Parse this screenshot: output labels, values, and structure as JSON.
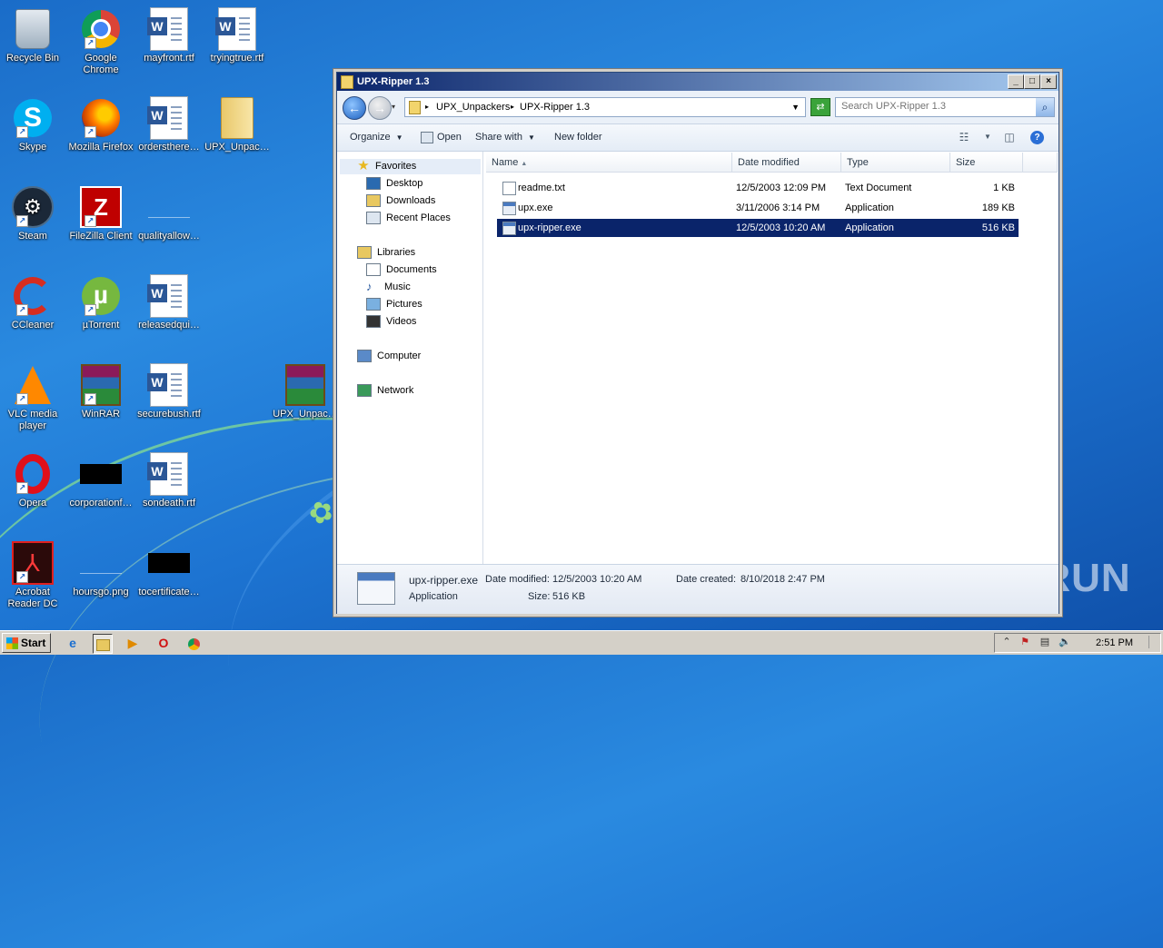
{
  "desktop": {
    "icons": [
      {
        "label": "Recycle Bin",
        "icon": "recycle-bin-icon"
      },
      {
        "label": "Google Chrome",
        "icon": "chrome-icon"
      },
      {
        "label": "mayfront.rtf",
        "icon": "word-doc-icon"
      },
      {
        "label": "tryingtrue.rtf",
        "icon": "word-doc-icon"
      },
      {
        "label": "Skype",
        "icon": "skype-icon"
      },
      {
        "label": "Mozilla Firefox",
        "icon": "firefox-icon"
      },
      {
        "label": "ordersthere…",
        "icon": "word-doc-icon"
      },
      {
        "label": "UPX_Unpac…",
        "icon": "folder-icon"
      },
      {
        "label": "Steam",
        "icon": "steam-icon"
      },
      {
        "label": "FileZilla Client",
        "icon": "filezilla-icon"
      },
      {
        "label": "qualityallow…",
        "icon": "blank-file-icon"
      },
      {
        "label": "CCleaner",
        "icon": "ccleaner-icon"
      },
      {
        "label": "µTorrent",
        "icon": "utorrent-icon"
      },
      {
        "label": "releasedqui…",
        "icon": "word-doc-icon"
      },
      {
        "label": "VLC media player",
        "icon": "vlc-icon"
      },
      {
        "label": "WinRAR",
        "icon": "winrar-icon"
      },
      {
        "label": "securebush.rtf",
        "icon": "word-doc-icon"
      },
      {
        "label": "UPX_Unpac…",
        "icon": "winrar-archive-icon"
      },
      {
        "label": "Opera",
        "icon": "opera-icon"
      },
      {
        "label": "corporationf…",
        "icon": "black-file-icon"
      },
      {
        "label": "sondeath.rtf",
        "icon": "word-doc-icon"
      },
      {
        "label": "Acrobat Reader DC",
        "icon": "acrobat-icon"
      },
      {
        "label": "hoursgo.png",
        "icon": "blank-file-icon"
      },
      {
        "label": "tocertificate…",
        "icon": "black-file-icon"
      }
    ]
  },
  "window": {
    "title": "UPX-Ripper 1.3",
    "controls": {
      "minimize": "_",
      "maximize": "□",
      "close": "×"
    },
    "breadcrumb": [
      "UPX_Unpackers",
      "UPX-Ripper 1.3"
    ],
    "search_placeholder": "Search UPX-Ripper 1.3",
    "toolbar": {
      "organize": "Organize",
      "open": "Open",
      "share_with": "Share with",
      "new_folder": "New folder"
    },
    "nav": {
      "favorites": "Favorites",
      "desktop": "Desktop",
      "downloads": "Downloads",
      "recent_places": "Recent Places",
      "libraries": "Libraries",
      "documents": "Documents",
      "music": "Music",
      "pictures": "Pictures",
      "videos": "Videos",
      "computer": "Computer",
      "network": "Network"
    },
    "columns": {
      "name": "Name",
      "date_modified": "Date modified",
      "type": "Type",
      "size": "Size"
    },
    "files": [
      {
        "name": "readme.txt",
        "date": "12/5/2003 12:09 PM",
        "type": "Text Document",
        "size": "1 KB"
      },
      {
        "name": "upx.exe",
        "date": "3/11/2006 3:14 PM",
        "type": "Application",
        "size": "189 KB"
      },
      {
        "name": "upx-ripper.exe",
        "date": "12/5/2003 10:20 AM",
        "type": "Application",
        "size": "516 KB"
      }
    ],
    "details": {
      "name": "upx-ripper.exe",
      "date_modified_label": "Date modified:",
      "date_modified": "12/5/2003 10:20 AM",
      "date_created_label": "Date created:",
      "date_created": "8/10/2018 2:47 PM",
      "type": "Application",
      "size_label": "Size:",
      "size": "516 KB"
    }
  },
  "watermark": "ANY RUN",
  "taskbar": {
    "start": "Start",
    "clock": "2:51 PM"
  }
}
